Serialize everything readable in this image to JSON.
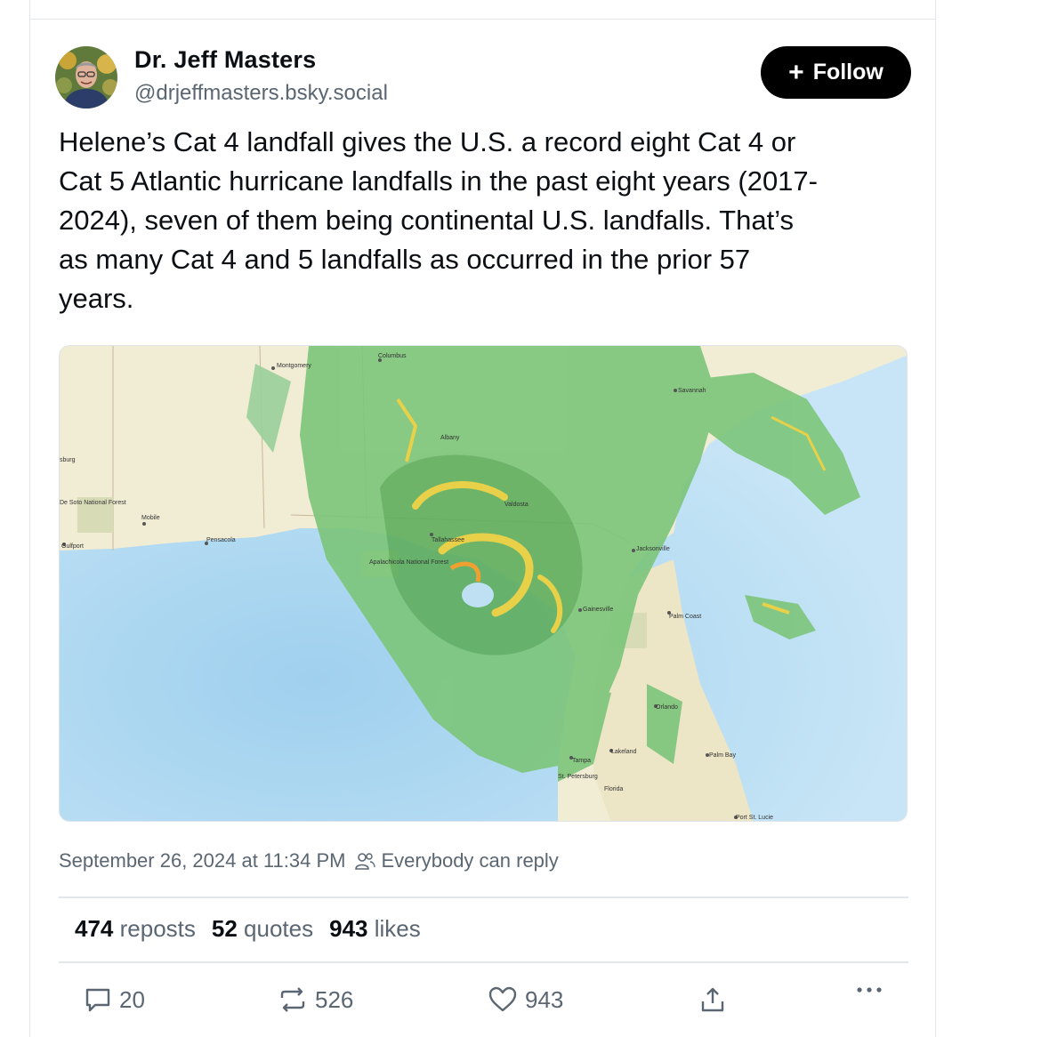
{
  "author": {
    "name": "Dr. Jeff Masters",
    "handle": "@drjeffmasters.bsky.social"
  },
  "follow_label": "Follow",
  "post_text": "Helene’s Cat 4 landfall gives the U.S. a record eight Cat 4 or Cat 5 Atlantic hurricane landfalls in the past eight years (2017-2024), seven of them being continental U.S. landfalls. That’s as many Cat 4 and 5 landfalls as occurred in the prior 57 years.",
  "post_text_lines": [
    "Helene’s Cat 4 landfall gives the U.S. a record eight Cat 4 or",
    "Cat 5 Atlantic hurricane landfalls in the past eight years (2017-",
    "2024), seven of them being continental U.S. landfalls. That’s",
    "as many Cat 4 and 5 landfalls as occurred in the prior 57",
    "years."
  ],
  "map_labels": {
    "montgomery": "Montgomery",
    "columbus": "Columbus",
    "savannah": "Savannah",
    "mobile": "Mobile",
    "pensacola": "Pensacola",
    "gulfport": "Gulfport",
    "tallahassee": "Tallahassee",
    "jacksonville": "Jacksonville",
    "gainesville": "Gainesville",
    "palm_coast": "Palm Coast",
    "orlando": "Orlando",
    "tampa": "Tampa",
    "st_petersburg": "St. Petersburg",
    "lakeland": "Lakeland",
    "palm_bay": "Palm Bay",
    "port_st_lucie": "Port St. Lucie",
    "florida": "Florida",
    "de_soto": "De Soto National Forest",
    "albany": "Albany",
    "valdosta": "Valdosta",
    "apalachicola": "Apalachicola National Forest",
    "hattiesburg": "sburg"
  },
  "timestamp": "September 26, 2024 at 11:34 PM",
  "reply_setting": "Everybody can reply",
  "stats": {
    "reposts_count": "474",
    "reposts_label": "reposts",
    "quotes_count": "52",
    "quotes_label": "quotes",
    "likes_count": "943",
    "likes_label": "likes"
  },
  "actions": {
    "replies": "20",
    "reposts": "526",
    "likes": "943"
  },
  "colors": {
    "text": "#0b0f14",
    "muted": "#5b6673",
    "follow_bg": "#000000",
    "radar_green": "#6cc26a",
    "radar_yellow": "#e8d048",
    "water": "#bfe0f3",
    "land": "#f1ecd4"
  }
}
